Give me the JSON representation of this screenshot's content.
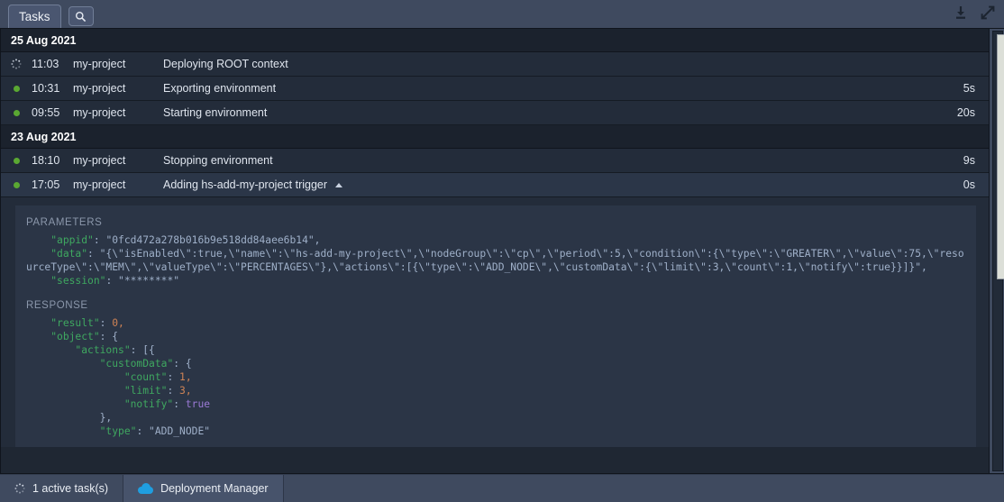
{
  "window": {
    "tab_label": "Tasks",
    "search_icon": "search-icon",
    "download_icon": "download-icon",
    "expand_icon": "expand-icon"
  },
  "groups": [
    {
      "date": "25 Aug 2021",
      "rows": [
        {
          "status": "running",
          "time": "11:03",
          "project": "my-project",
          "title": "Deploying ROOT context",
          "duration": ""
        },
        {
          "status": "ok",
          "time": "10:31",
          "project": "my-project",
          "title": "Exporting environment",
          "duration": "5s"
        },
        {
          "status": "ok",
          "time": "09:55",
          "project": "my-project",
          "title": "Starting environment",
          "duration": "20s"
        }
      ]
    },
    {
      "date": "23 Aug 2021",
      "rows": [
        {
          "status": "ok",
          "time": "18:10",
          "project": "my-project",
          "title": "Stopping environment",
          "duration": "9s"
        },
        {
          "status": "ok",
          "time": "17:05",
          "project": "my-project",
          "title": "Adding hs-add-my-project trigger",
          "duration": "0s",
          "selected": true,
          "expanded": true
        }
      ]
    }
  ],
  "detail": {
    "parameters_label": "PARAMETERS",
    "response_label": "RESPONSE",
    "parameters": [
      {
        "indent": 4,
        "key": "appid",
        "value": "\"0fcd472a278b016b9e518dd84aee6b14\",",
        "type": "string"
      },
      {
        "indent": 4,
        "key": "data",
        "value": "\"{\\\"isEnabled\\\":true,\\\"name\\\":\\\"hs-add-my-project\\\",\\\"nodeGroup\\\":\\\"cp\\\",\\\"period\\\":5,\\\"condition\\\":{\\\"type\\\":\\\"GREATER\\\",\\\"value\\\":75,\\\"resourceType\\\":\\\"MEM\\\",\\\"valueType\\\":\\\"PERCENTAGES\\\"},\\\"actions\\\":[{\\\"type\\\":\\\"ADD_NODE\\\",\\\"customData\\\":{\\\"limit\\\":3,\\\"count\\\":1,\\\"notify\\\":true}}]}\",",
        "type": "string"
      },
      {
        "indent": 4,
        "key": "session",
        "value": "\"********\"",
        "type": "string"
      }
    ],
    "response": [
      {
        "indent": 4,
        "key": "result",
        "value": "0,",
        "type": "number"
      },
      {
        "indent": 4,
        "key": "object",
        "value": "{",
        "type": "plain"
      },
      {
        "indent": 8,
        "key": "actions",
        "value": "[{",
        "type": "plain"
      },
      {
        "indent": 12,
        "key": "customData",
        "value": "{",
        "type": "plain"
      },
      {
        "indent": 16,
        "key": "count",
        "value": "1,",
        "type": "number"
      },
      {
        "indent": 16,
        "key": "limit",
        "value": "3,",
        "type": "number"
      },
      {
        "indent": 16,
        "key": "notify",
        "value": "true",
        "type": "bool"
      },
      {
        "indent": 12,
        "key": null,
        "value": "},",
        "type": "plain"
      },
      {
        "indent": 12,
        "key": "type",
        "value": "\"ADD_NODE\"",
        "type": "string"
      }
    ]
  },
  "statusbar": {
    "active_tasks": "1 active task(s)",
    "deployment_manager": "Deployment Manager"
  }
}
